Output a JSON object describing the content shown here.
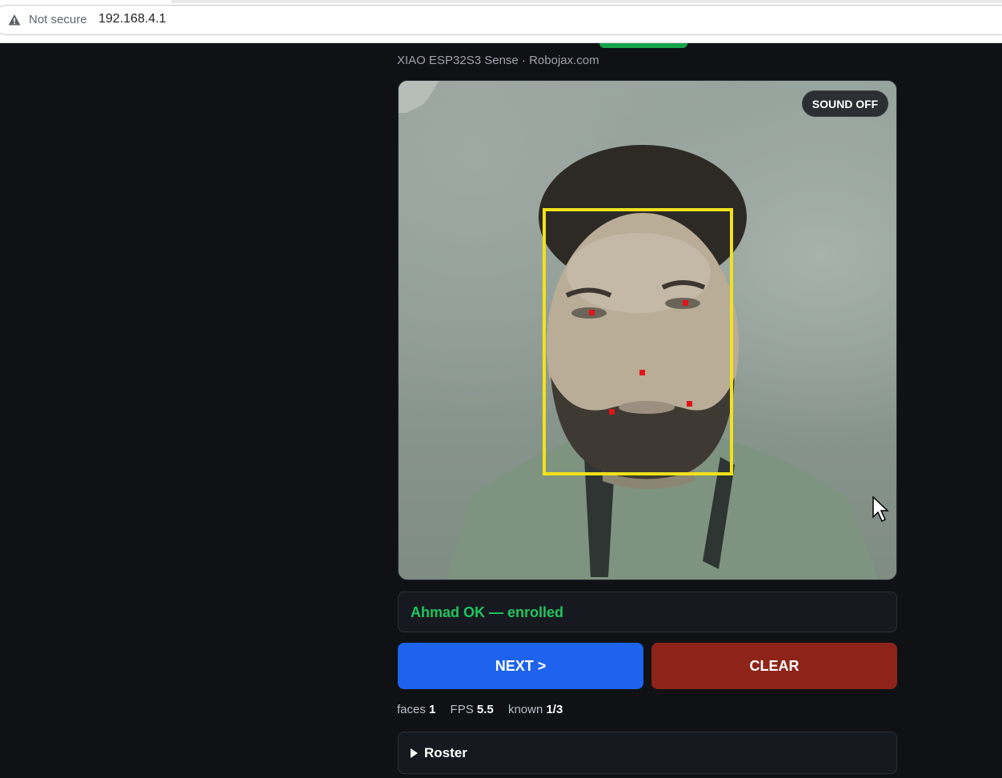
{
  "browser": {
    "security_label": "Not secure",
    "url": "192.168.4.1"
  },
  "header": {
    "subtitle": "XIAO ESP32S3 Sense · Robojax.com"
  },
  "camera": {
    "sound_button": "SOUND OFF",
    "box_color": "#f2e21b",
    "landmark_color": "#e0141a"
  },
  "status": {
    "message": "Ahmad OK — enrolled",
    "color": "#22c55e"
  },
  "controls": {
    "next_label": "NEXT >",
    "clear_label": "CLEAR"
  },
  "stats": {
    "faces_label": "faces",
    "faces_value": "1",
    "fps_label": "FPS",
    "fps_value": "5.5",
    "known_label": "known",
    "known_value": "1/3"
  },
  "roster": {
    "label": "Roster"
  }
}
